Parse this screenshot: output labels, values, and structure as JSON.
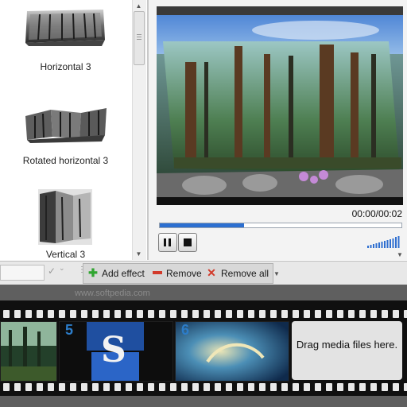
{
  "effects": {
    "items": [
      {
        "label": "Horizontal 3"
      },
      {
        "label": "Rotated horizontal 3"
      },
      {
        "label": "Vertical 3"
      }
    ]
  },
  "preview": {
    "time": "00:00/00:02",
    "progress": 0.35
  },
  "toolbar": {
    "add_effect": "Add effect",
    "remove": "Remove",
    "remove_all": "Remove all"
  },
  "watermark": "www.softpedia.com",
  "timeline": {
    "clips": [
      {
        "number": ""
      },
      {
        "number": "5"
      },
      {
        "number": "6"
      }
    ],
    "drop_zone_text": "Drag media files here."
  },
  "colors": {
    "accent": "#2c6fd0",
    "add_icon": "#2fa52f",
    "remove_icon": "#d23a2a",
    "clip_number": "#2c7cc8"
  }
}
